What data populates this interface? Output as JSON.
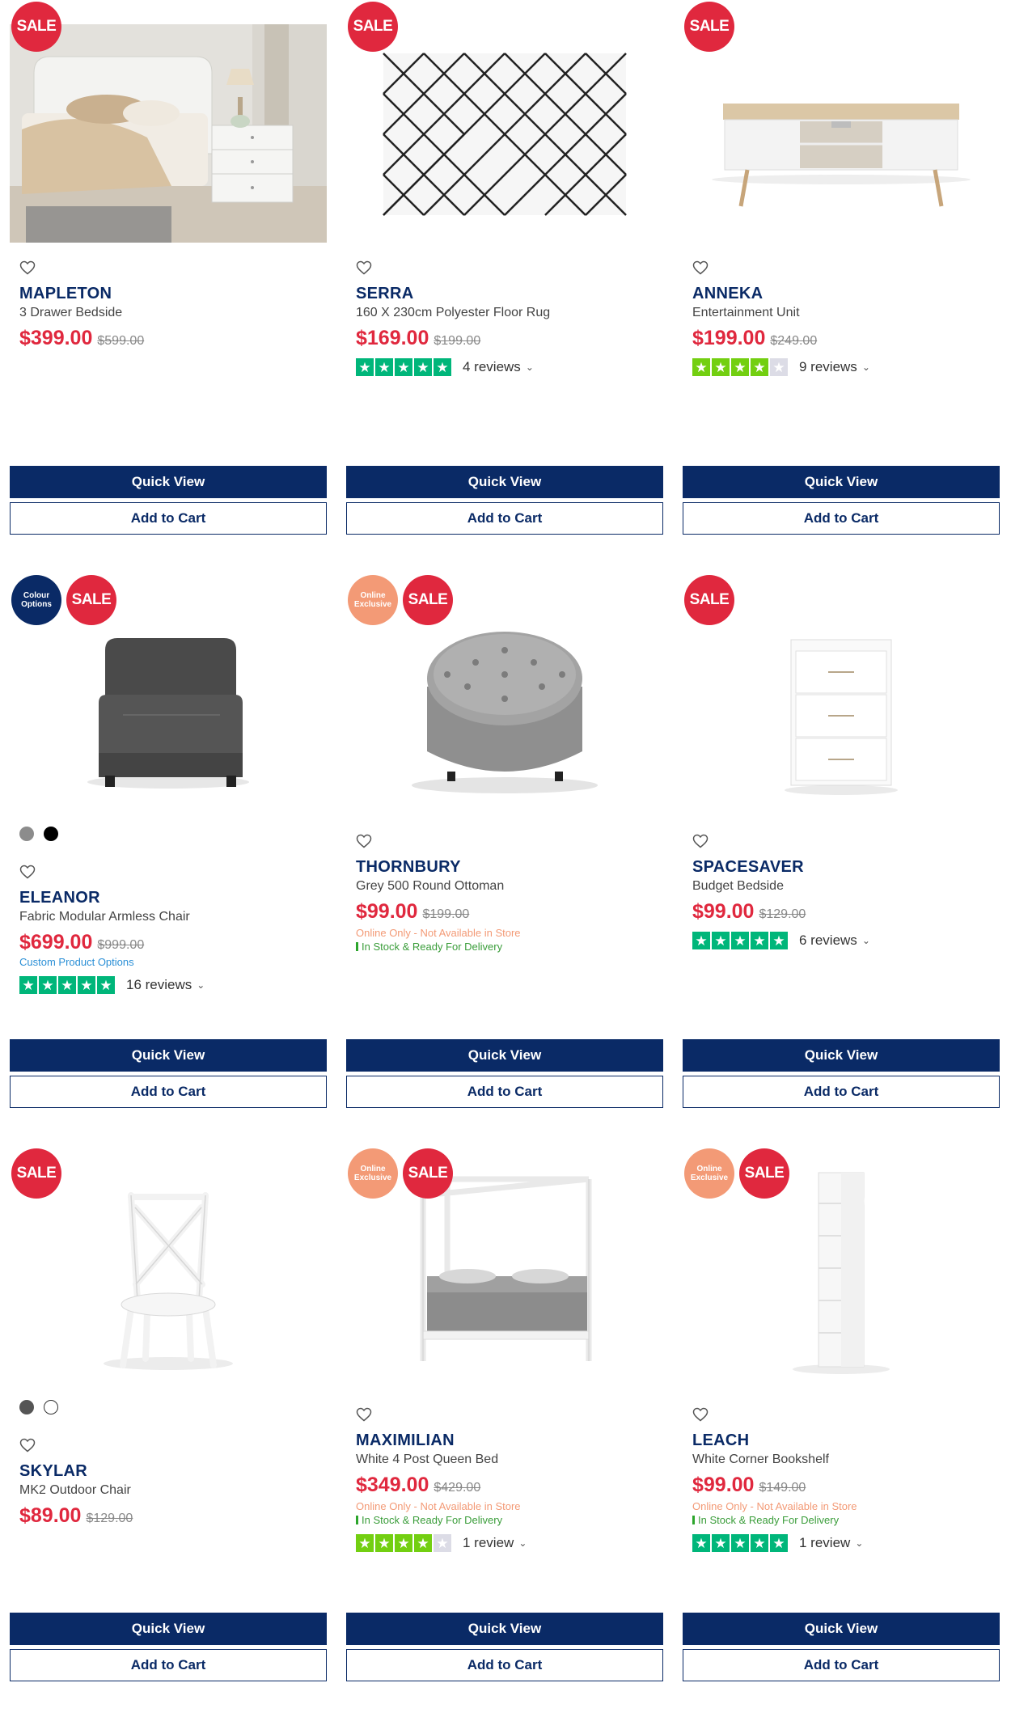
{
  "products": [
    {
      "badges": [
        {
          "type": "sale",
          "text": "SALE"
        }
      ],
      "image": "bedside-room-photo",
      "name": "MAPLETON",
      "desc": "3 Drawer Bedside",
      "price": "$399.00",
      "was": "$599.00",
      "quick_view": "Quick View",
      "add_to_cart": "Add to Cart"
    },
    {
      "badges": [
        {
          "type": "sale",
          "text": "SALE"
        }
      ],
      "image": "diamond-rug",
      "name": "SERRA",
      "desc": "160 X 230cm Polyester Floor Rug",
      "price": "$169.00",
      "was": "$199.00",
      "rating": {
        "stars": 5,
        "reviews": "4 reviews"
      },
      "quick_view": "Quick View",
      "add_to_cart": "Add to Cart"
    },
    {
      "badges": [
        {
          "type": "sale",
          "text": "SALE"
        }
      ],
      "image": "tv-unit",
      "name": "ANNEKA",
      "desc": "Entertainment Unit",
      "price": "$199.00",
      "was": "$249.00",
      "rating": {
        "stars": 4,
        "reviews": "9 reviews"
      },
      "quick_view": "Quick View",
      "add_to_cart": "Add to Cart"
    },
    {
      "badges": [
        {
          "type": "colour",
          "text": "Colour Options"
        },
        {
          "type": "sale",
          "text": "SALE"
        }
      ],
      "image": "armless-chair",
      "swatches": [
        "#8c8c8c",
        "#000000"
      ],
      "name": "ELEANOR",
      "desc": "Fabric Modular Armless Chair",
      "price": "$699.00",
      "was": "$999.00",
      "custom": "Custom Product Options",
      "rating": {
        "stars": 5,
        "reviews": "16 reviews"
      },
      "quick_view": "Quick View",
      "add_to_cart": "Add to Cart"
    },
    {
      "badges": [
        {
          "type": "online",
          "text": "Online Exclusive"
        },
        {
          "type": "sale",
          "text": "SALE"
        }
      ],
      "image": "round-ottoman",
      "name": "THORNBURY",
      "desc": "Grey 500 Round Ottoman",
      "price": "$99.00",
      "was": "$199.00",
      "online_note": "Online Only - Not Available in Store",
      "stock_note": "In Stock & Ready For Delivery",
      "quick_view": "Quick View",
      "add_to_cart": "Add to Cart"
    },
    {
      "badges": [
        {
          "type": "sale",
          "text": "SALE"
        }
      ],
      "image": "white-bedside",
      "name": "SPACESAVER",
      "desc": "Budget Bedside",
      "price": "$99.00",
      "was": "$129.00",
      "rating": {
        "stars": 5,
        "reviews": "6 reviews"
      },
      "quick_view": "Quick View",
      "add_to_cart": "Add to Cart"
    },
    {
      "badges": [
        {
          "type": "sale",
          "text": "SALE"
        }
      ],
      "image": "cross-back-chair",
      "swatches": [
        "#555555",
        "#ffffff"
      ],
      "name": "SKYLAR",
      "desc": "MK2 Outdoor Chair",
      "price": "$89.00",
      "was": "$129.00",
      "quick_view": "Quick View",
      "add_to_cart": "Add to Cart"
    },
    {
      "badges": [
        {
          "type": "online",
          "text": "Online Exclusive"
        },
        {
          "type": "sale",
          "text": "SALE"
        }
      ],
      "image": "four-post-bed",
      "name": "MAXIMILIAN",
      "desc": "White 4 Post Queen Bed",
      "price": "$349.00",
      "was": "$429.00",
      "online_note": "Online Only - Not Available in Store",
      "stock_note": "In Stock & Ready For Delivery",
      "rating": {
        "stars": 4,
        "reviews": "1 review"
      },
      "quick_view": "Quick View",
      "add_to_cart": "Add to Cart"
    },
    {
      "badges": [
        {
          "type": "online",
          "text": "Online Exclusive"
        },
        {
          "type": "sale",
          "text": "SALE"
        }
      ],
      "image": "corner-bookshelf",
      "name": "LEACH",
      "desc": "White Corner Bookshelf",
      "price": "$99.00",
      "was": "$149.00",
      "online_note": "Online Only - Not Available in Store",
      "stock_note": "In Stock & Ready For Delivery",
      "rating": {
        "stars": 5,
        "reviews": "1 review"
      },
      "quick_view": "Quick View",
      "add_to_cart": "Add to Cart"
    }
  ],
  "colors": {
    "navy": "#0a2a66",
    "sale_red": "#e0283e",
    "trustpilot_green": "#00b67a",
    "online_orange": "#f39a76",
    "stock_green": "#3a9d3a"
  }
}
